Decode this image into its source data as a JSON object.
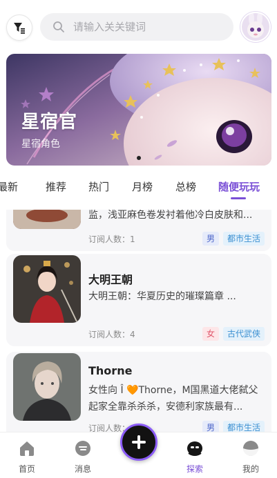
{
  "search": {
    "placeholder": "请输入关关键词"
  },
  "banner": {
    "title": "星宿官",
    "subtitle": "星宿角色"
  },
  "tabs": [
    "最新",
    "推荐",
    "热门",
    "月榜",
    "总榜",
    "随便玩玩"
  ],
  "active_tab": "随便玩玩",
  "cards": [
    {
      "name": "",
      "description": "监，浅亚麻色卷发衬着他冷白皮肤和...",
      "subscribers_label": "订阅人数：1",
      "tags": [
        "男",
        "都市生活"
      ]
    },
    {
      "name": "大明王朝",
      "description": "大明王朝：华夏历史的璀璨篇章 ...",
      "subscribers_label": "订阅人数：4",
      "tags": [
        "女",
        "古代武侠"
      ]
    },
    {
      "name": "Thorne",
      "description": "女性向 Î 🧡Thorne，M国黑道大佬弑父起家全靠杀杀杀，安德利家族最有...",
      "subscribers_label": "订阅人数：1",
      "tags": [
        "男",
        "都市生活"
      ]
    }
  ],
  "nav": {
    "home": "首页",
    "messages": "消息",
    "explore": "探索",
    "mine": "我的"
  },
  "colors": {
    "accent": "#7a4fd6",
    "fab_ring": "#8b5cf6",
    "tag_male": "#4f67c9",
    "tag_female": "#e0556a",
    "tag_genre": "#3a8fd1"
  },
  "icons": [
    "filter-icon",
    "search-icon",
    "plus-icon",
    "home-icon",
    "message-icon",
    "explore-icon",
    "profile-icon"
  ]
}
